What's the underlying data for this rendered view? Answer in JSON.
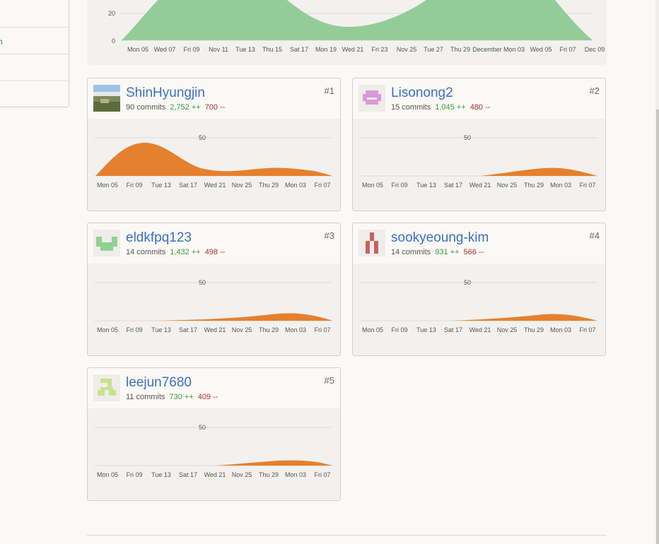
{
  "sidebar": {
    "items": [
      {
        "label": ""
      },
      {
        "label": "h"
      },
      {
        "label": ""
      },
      {
        "label": ""
      }
    ]
  },
  "overview": {
    "y_ticks": [
      "20",
      "0"
    ],
    "x_ticks": [
      "Mon 05",
      "Wed 07",
      "Fri 09",
      "Nov 11",
      "Tue 13",
      "Thu 15",
      "Sat 17",
      "Mon 19",
      "Wed 21",
      "Fri 23",
      "Nov 25",
      "Tue 27",
      "Thu 29",
      "December",
      "Mon 03",
      "Wed 05",
      "Fri 07",
      "Dec 09"
    ],
    "color": "#94cc98"
  },
  "contributors": [
    {
      "rank": "#1",
      "name": "ShinHyungjin",
      "commits": "90 commits",
      "additions": "2,752 ++",
      "deletions": "700 --",
      "y_tick": "50",
      "x_ticks": [
        "Mon 05",
        "Fri 09",
        "Tue 13",
        "Sat 17",
        "Wed 21",
        "Nov 25",
        "Thu 29",
        "Mon 03",
        "Fri 07"
      ]
    },
    {
      "rank": "#2",
      "name": "Lisonong2",
      "commits": "15 commits",
      "additions": "1,045 ++",
      "deletions": "480 --",
      "y_tick": "50",
      "x_ticks": [
        "Mon 05",
        "Fri 09",
        "Tue 13",
        "Sat 17",
        "Wed 21",
        "Nov 25",
        "Thu 29",
        "Mon 03",
        "Fri 07"
      ]
    },
    {
      "rank": "#3",
      "name": "eldkfpq123",
      "commits": "14 commits",
      "additions": "1,432 ++",
      "deletions": "498 --",
      "y_tick": "50",
      "x_ticks": [
        "Mon 05",
        "Fri 09",
        "Tue 13",
        "Sat 17",
        "Wed 21",
        "Nov 25",
        "Thu 29",
        "Mon 03",
        "Fri 07"
      ]
    },
    {
      "rank": "#4",
      "name": "sookyeoung-kim",
      "commits": "14 commits",
      "additions": "931 ++",
      "deletions": "566 --",
      "y_tick": "50",
      "x_ticks": [
        "Mon 05",
        "Fri 09",
        "Tue 13",
        "Sat 17",
        "Wed 21",
        "Nov 25",
        "Thu 29",
        "Mon 03",
        "Fri 07"
      ]
    },
    {
      "rank": "#5",
      "name": "leejun7680",
      "commits": "11 commits",
      "additions": "730 ++",
      "deletions": "409 --",
      "y_tick": "50",
      "x_ticks": [
        "Mon 05",
        "Fri 09",
        "Tue 13",
        "Sat 17",
        "Wed 21",
        "Nov 25",
        "Thu 29",
        "Mon 03",
        "Fri 07"
      ]
    }
  ],
  "colors": {
    "link": "#3b6fc1",
    "additions": "#3b9a3b",
    "deletions": "#a83232",
    "contrib_area": "#e5802e",
    "overview_area": "#94cc98"
  }
}
